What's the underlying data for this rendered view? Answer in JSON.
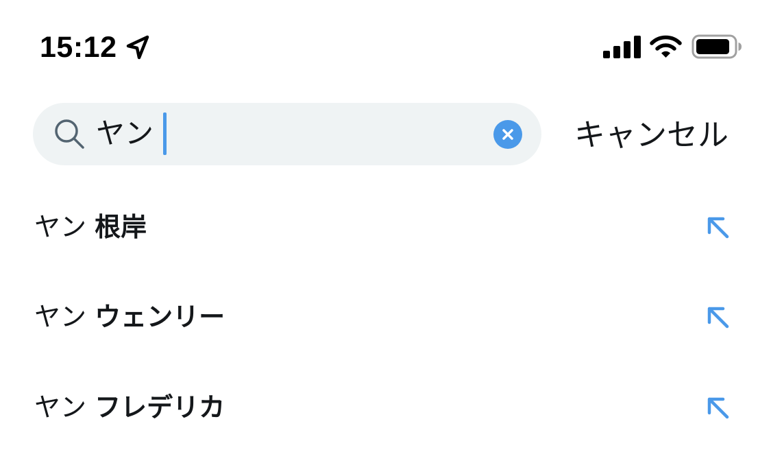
{
  "status_bar": {
    "time": "15:12",
    "icons": [
      "location-arrow-icon",
      "cellular-signal-icon",
      "wifi-icon",
      "battery-icon"
    ]
  },
  "search": {
    "query": "ヤン",
    "cancel_label": "キャンセル",
    "icons": [
      "search-icon",
      "clear-icon"
    ]
  },
  "suggestions": [
    {
      "prefix": "ヤン ",
      "rest": "根岸"
    },
    {
      "prefix": "ヤン ",
      "rest": "ウェンリー"
    },
    {
      "prefix": "ヤン ",
      "rest": "フレデリカ"
    }
  ],
  "colors": {
    "accent": "#4a99e9",
    "search_bg": "#eff3f4",
    "text": "#14171a",
    "icon_gray": "#536471"
  }
}
